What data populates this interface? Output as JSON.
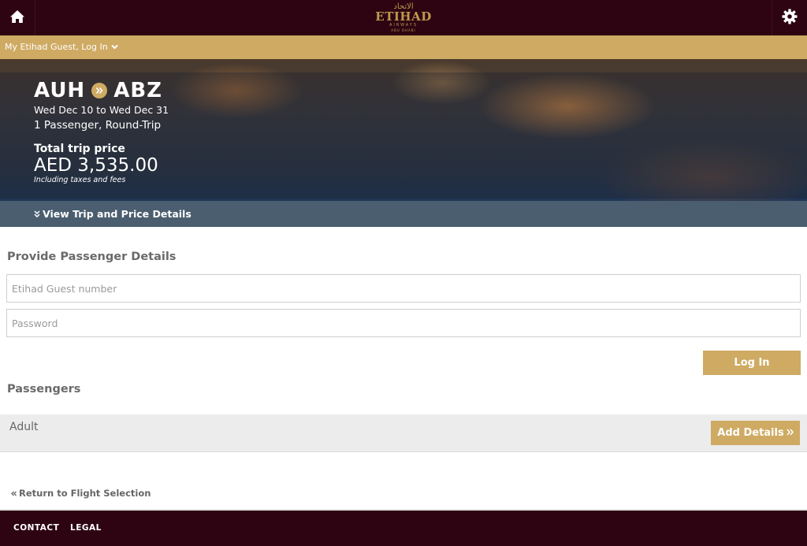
{
  "header": {
    "logo_arabic": "الاتحاد",
    "logo_brand": "ETIHAD",
    "logo_sub": "AIRWAYS",
    "logo_city": "ABU DHABI",
    "home_icon": "home-icon",
    "settings_icon": "gear-icon"
  },
  "login_bar": {
    "label": "My Etihad Guest, Log In"
  },
  "trip": {
    "origin": "AUH",
    "destination": "ABZ",
    "dates": "Wed Dec 10 to Wed Dec 31",
    "passengers": "1 Passenger, Round-Trip",
    "price_label": "Total trip price",
    "price": "AED 3,535.00",
    "price_note": "Including taxes and fees"
  },
  "details_bar": {
    "label": "View Trip and Price Details"
  },
  "form": {
    "title": "Provide Passenger Details",
    "guest_number_placeholder": "Etihad Guest number",
    "password_placeholder": "Password",
    "login_button": "Log In"
  },
  "passengers": {
    "title": "Passengers",
    "rows": [
      {
        "type": "Adult",
        "button": "Add Details"
      }
    ]
  },
  "return_link": "Return to Flight Selection",
  "footer": {
    "links": [
      "CONTACT",
      "LEGAL"
    ]
  },
  "colors": {
    "header_bg": "#2e0412",
    "gold": "#cfaa63",
    "details_bar": "#4b5e70"
  }
}
